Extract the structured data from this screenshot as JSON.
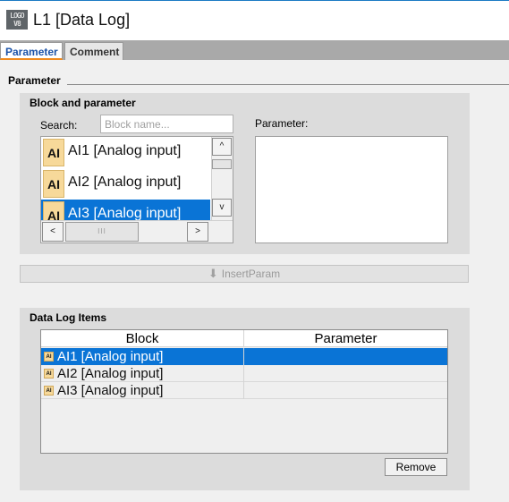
{
  "window": {
    "logo_top": "LOGO",
    "logo_bottom": "V8",
    "title": "L1 [Data Log]"
  },
  "tabs": [
    {
      "label": "Parameter",
      "active": true
    },
    {
      "label": "Comment",
      "active": false
    }
  ],
  "parameter_section": {
    "label": "Parameter"
  },
  "block_panel": {
    "title": "Block and parameter",
    "search_label": "Search:",
    "search_placeholder": "Block name...",
    "parameter_label": "Parameter:",
    "items": [
      {
        "icon": "AI",
        "label": "AI1 [Analog input]",
        "selected": false
      },
      {
        "icon": "AI",
        "label": "AI2 [Analog input]",
        "selected": false
      },
      {
        "icon": "AI",
        "label": "AI3 [Analog input]",
        "selected": true
      }
    ],
    "scroll_up": "^",
    "scroll_down": "v",
    "scroll_left": "<",
    "scroll_right": ">",
    "hthumb_grip": "III"
  },
  "insert_button": {
    "label": "InsertParam",
    "enabled": false
  },
  "log_panel": {
    "title": "Data Log Items",
    "columns": [
      "Block",
      "Parameter"
    ],
    "rows": [
      {
        "icon": "AI",
        "block": "AI1 [Analog input]",
        "parameter": "",
        "selected": true
      },
      {
        "icon": "AI",
        "block": "AI2 [Analog input]",
        "parameter": "",
        "selected": false
      },
      {
        "icon": "AI",
        "block": "AI3 [Analog input]",
        "parameter": "",
        "selected": false
      }
    ],
    "remove_label": "Remove"
  },
  "colors": {
    "selection": "#0a74d6",
    "active_tab_text": "#1a52a8",
    "active_tab_underline": "#f08a1e",
    "ai_icon_fill": "#f7d99a"
  }
}
